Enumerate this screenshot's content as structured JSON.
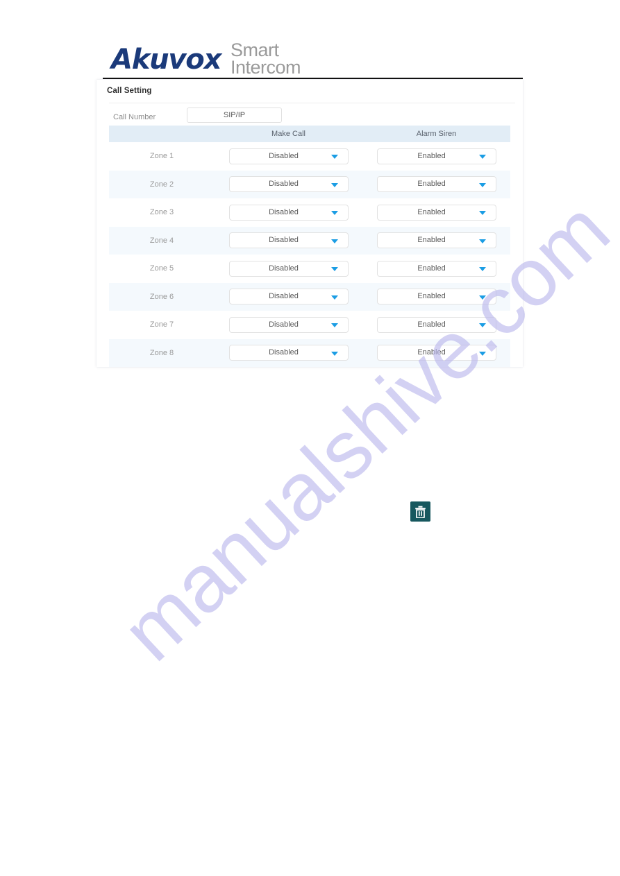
{
  "branding": {
    "logo_main": "Akuvox",
    "logo_tagline_line1": "Smart",
    "logo_tagline_line2": "Intercom",
    "logo_color": "#1b3a7a",
    "tagline_color": "#9a9a9a"
  },
  "watermark": {
    "text": "manualshive.com",
    "color": "#b9b6ec"
  },
  "panel": {
    "title": "Call Setting",
    "call_number": {
      "label": "Call Number",
      "value": "SIP/IP",
      "placeholder": "SIP/IP"
    },
    "table": {
      "headers": {
        "zone": "",
        "make_call": "Make Call",
        "alarm_siren": "Alarm Siren"
      },
      "rows": [
        {
          "zone": "Zone 1",
          "make_call": "Disabled",
          "alarm_siren": "Enabled"
        },
        {
          "zone": "Zone 2",
          "make_call": "Disabled",
          "alarm_siren": "Enabled"
        },
        {
          "zone": "Zone 3",
          "make_call": "Disabled",
          "alarm_siren": "Enabled"
        },
        {
          "zone": "Zone 4",
          "make_call": "Disabled",
          "alarm_siren": "Enabled"
        },
        {
          "zone": "Zone 5",
          "make_call": "Disabled",
          "alarm_siren": "Enabled"
        },
        {
          "zone": "Zone 6",
          "make_call": "Disabled",
          "alarm_siren": "Enabled"
        },
        {
          "zone": "Zone 7",
          "make_call": "Disabled",
          "alarm_siren": "Enabled"
        },
        {
          "zone": "Zone 8",
          "make_call": "Disabled",
          "alarm_siren": "Enabled"
        }
      ]
    },
    "colors": {
      "header_row_bg": "#e2edf6",
      "even_row_bg": "#f4f9fd",
      "dropdown_arrow": "#1b9de4"
    }
  },
  "delete_button": {
    "icon": "trash-icon",
    "background": "#17585e"
  }
}
